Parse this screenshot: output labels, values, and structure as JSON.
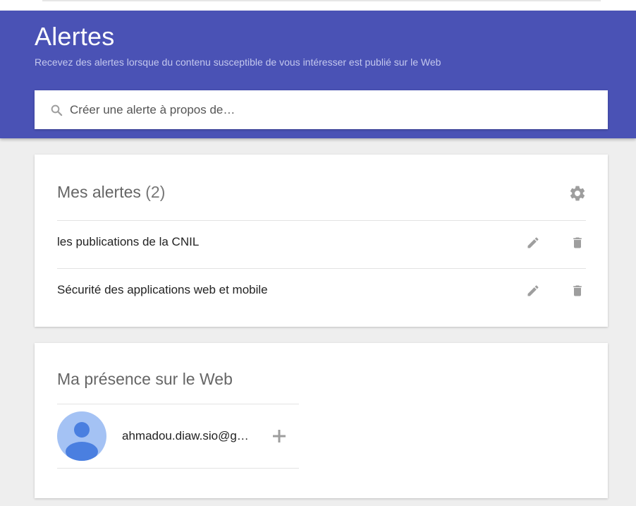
{
  "header": {
    "title": "Alertes",
    "subtitle": "Recevez des alertes lorsque du contenu susceptible de vous intéresser est publié sur le Web",
    "background_color": "#4a52b5"
  },
  "search": {
    "placeholder": "Créer une alerte à propos de…",
    "value": "",
    "icon": "search-icon"
  },
  "alerts_card": {
    "title": "Mes alertes",
    "count": "(2)",
    "settings_icon": "gear-icon",
    "items": [
      {
        "label": "les publications de la CNIL",
        "edit_icon": "pencil-icon",
        "delete_icon": "trash-icon"
      },
      {
        "label": "Sécurité des applications web et mobile",
        "edit_icon": "pencil-icon",
        "delete_icon": "trash-icon"
      }
    ]
  },
  "presence_card": {
    "title": "Ma présence sur le Web",
    "account": {
      "email": "ahmadou.diaw.sio@g…",
      "avatar_icon": "avatar-icon",
      "add_icon": "plus-icon"
    }
  }
}
